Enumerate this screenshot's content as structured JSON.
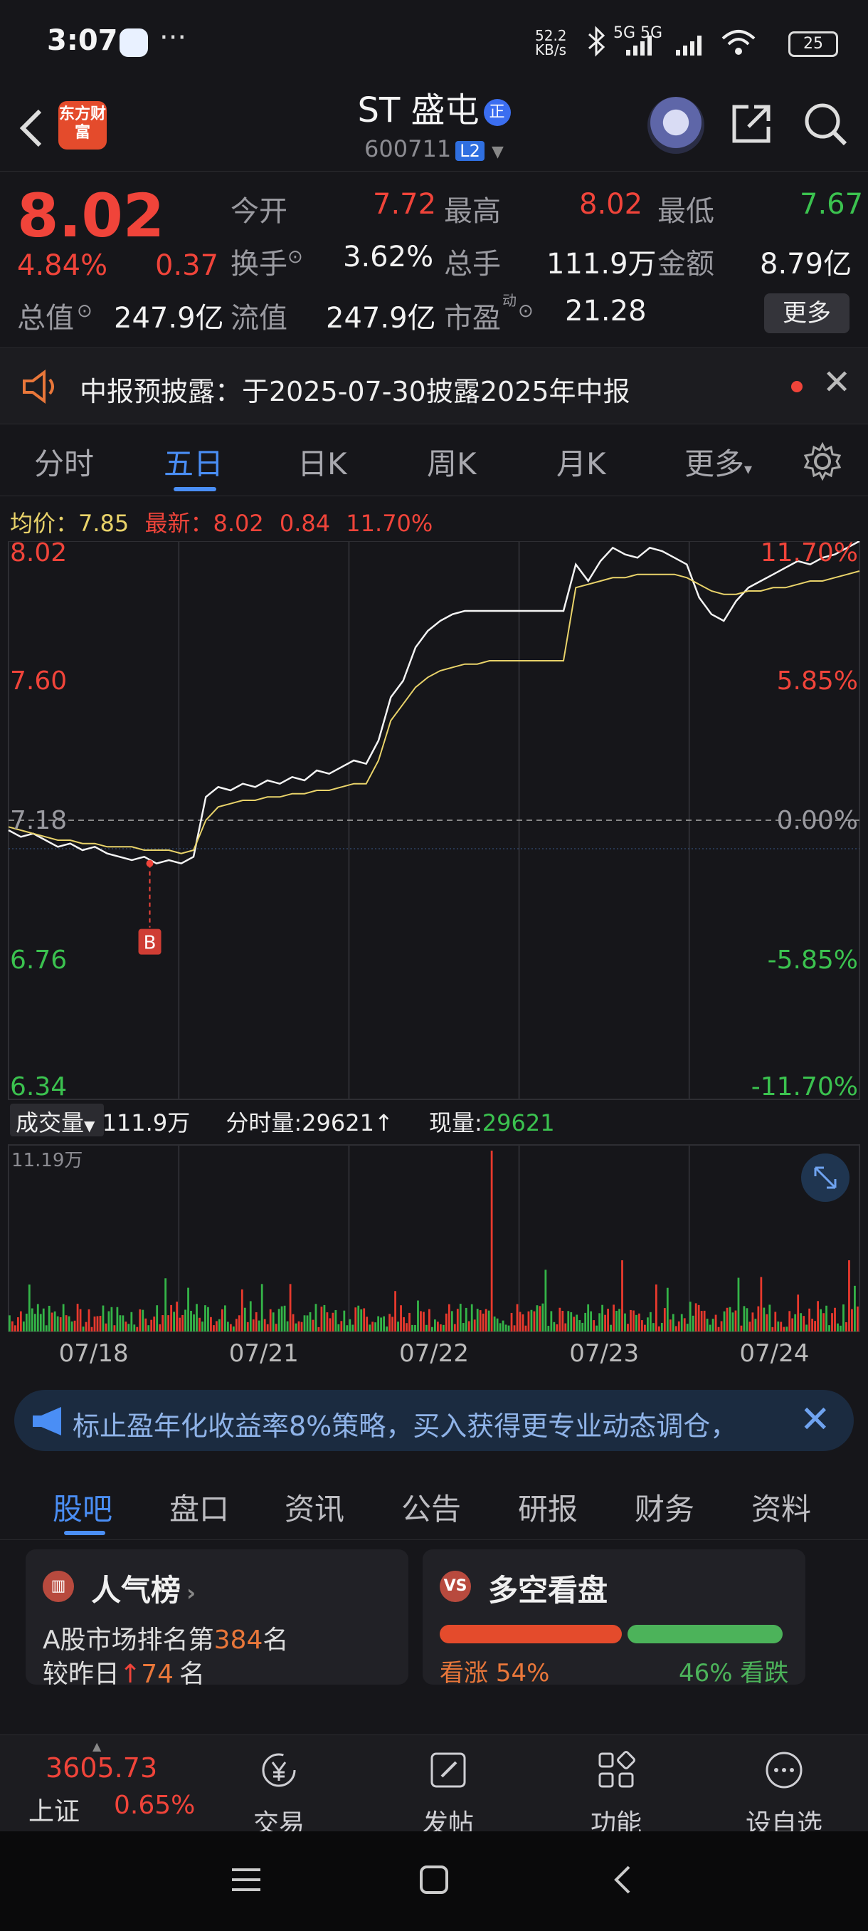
{
  "status_bar": {
    "time": "3:07",
    "dots": "···",
    "net_speed": "52.2 KB/s",
    "signal": "5G 5G",
    "battery": "25"
  },
  "header": {
    "logo_text": "东方财富",
    "stock_name": "ST 盛屯",
    "badge": "正",
    "code": "600711",
    "level": "L2"
  },
  "quote": {
    "price": "8.02",
    "change_pct": "4.84%",
    "change": "0.37",
    "rows": [
      {
        "l1": "今开",
        "v1": "7.72",
        "l2": "最高",
        "v2": "8.02",
        "l3": "最低",
        "v3": "7.67"
      },
      {
        "l1": "换手",
        "v1": "3.62%",
        "l2": "总手",
        "v2": "111.9万",
        "l3": "金额",
        "v3": "8.79亿"
      },
      {
        "l1": "总值",
        "v1": "247.9亿",
        "l2": "流值",
        "v2": "247.9亿",
        "l3": "市盈",
        "v3": "21.28"
      }
    ],
    "more": "更多",
    "dong": "动"
  },
  "notice": {
    "text": "中报预披露：于2025-07-30披露2025年中报"
  },
  "chart_tabs": [
    "分时",
    "五日",
    "日K",
    "周K",
    "月K",
    "更多"
  ],
  "chart_info": {
    "avg_label": "均价：",
    "avg": "7.85",
    "latest_label": "最新：",
    "latest": "8.02",
    "chg": "0.84",
    "chg_pct": "11.70%"
  },
  "chart_data": {
    "type": "line",
    "y_labels_left": [
      "8.02",
      "7.60",
      "7.18",
      "6.76",
      "6.34"
    ],
    "y_labels_right": [
      "11.70%",
      "5.85%",
      "0.00%",
      "-5.85%",
      "-11.70%"
    ],
    "x_labels": [
      "07/18",
      "07/21",
      "07/22",
      "07/23",
      "07/24"
    ],
    "ylim": [
      6.34,
      8.02
    ],
    "prev_close": 7.18,
    "marker": "B",
    "volume_max_label": "11.19万",
    "series": [
      {
        "values": [
          7.15,
          7.13,
          7.14,
          7.12,
          7.1,
          7.11,
          7.09,
          7.1,
          7.08,
          7.07,
          7.06,
          7.07,
          7.05,
          7.06,
          7.05,
          7.07,
          7.25,
          7.28,
          7.27,
          7.29,
          7.28,
          7.3,
          7.29,
          7.31,
          7.3,
          7.33,
          7.32,
          7.34,
          7.36,
          7.35,
          7.42,
          7.55,
          7.6,
          7.7,
          7.75,
          7.78,
          7.8,
          7.81,
          7.81,
          7.81,
          7.81,
          7.81,
          7.81,
          7.81,
          7.81,
          7.81,
          7.95,
          7.9,
          7.96,
          8.0,
          7.98,
          7.97,
          8.0,
          7.99,
          7.97,
          7.95,
          7.85,
          7.8,
          7.78,
          7.84,
          7.88,
          7.9,
          7.92,
          7.94,
          7.96,
          7.95,
          7.97,
          7.98,
          8.0,
          8.02
        ]
      },
      {
        "values": [
          7.16,
          7.15,
          7.14,
          7.13,
          7.12,
          7.12,
          7.11,
          7.11,
          7.1,
          7.1,
          7.1,
          7.09,
          7.09,
          7.09,
          7.08,
          7.09,
          7.18,
          7.22,
          7.23,
          7.24,
          7.24,
          7.25,
          7.25,
          7.26,
          7.26,
          7.27,
          7.27,
          7.28,
          7.29,
          7.29,
          7.36,
          7.48,
          7.53,
          7.58,
          7.61,
          7.63,
          7.64,
          7.65,
          7.65,
          7.66,
          7.66,
          7.66,
          7.66,
          7.66,
          7.66,
          7.66,
          7.88,
          7.89,
          7.9,
          7.91,
          7.91,
          7.92,
          7.92,
          7.92,
          7.92,
          7.91,
          7.89,
          7.87,
          7.86,
          7.86,
          7.87,
          7.87,
          7.88,
          7.88,
          7.89,
          7.9,
          7.9,
          7.91,
          7.92,
          7.93
        ]
      }
    ]
  },
  "volume": {
    "label": "成交量",
    "total": "111.9万",
    "fenshi_label": "分时量:",
    "fenshi": "29621",
    "arrow": "↑",
    "xian_label": "现量:",
    "xian": "29621"
  },
  "banner": {
    "text": "标止盈年化收益率8%策略，买入获得更专业动态调仓，"
  },
  "info_tabs": [
    "股吧",
    "盘口",
    "资讯",
    "公告",
    "研报",
    "财务",
    "资料"
  ],
  "popularity": {
    "title": "人气榜",
    "line1_pre": "A股市场排名第",
    "rank": "384",
    "line1_post": "名",
    "line2_pre": "较昨日",
    "delta": "74",
    "line2_post": "名"
  },
  "sentiment": {
    "title": "多空看盘",
    "icon": "VS",
    "bull_label": "看涨",
    "bull": "54%",
    "bear": "46%",
    "bear_label": "看跌",
    "bull_fraction": 0.54
  },
  "bottom_nav": {
    "index_value": "3605.73",
    "index_name": "上证",
    "index_pct": "0.65%",
    "items": [
      "交易",
      "发帖",
      "功能",
      "设自选"
    ]
  },
  "colors": {
    "up": "#f0443a",
    "down": "#3bc24f",
    "accent": "#4a8ef5"
  }
}
